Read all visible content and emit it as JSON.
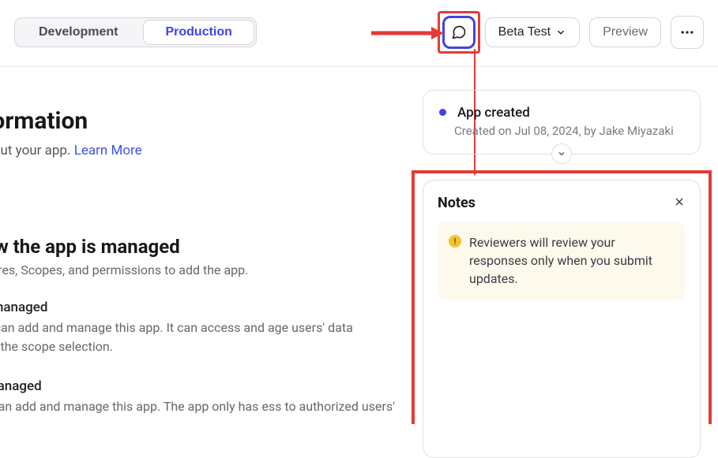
{
  "tabs": {
    "development": "Development",
    "production": "Production"
  },
  "toolbar": {
    "beta_test": "Beta Test",
    "preview": "Preview"
  },
  "page": {
    "title": "c Information",
    "subtitle_prefix": " information about your app. ",
    "learn_more": "Learn More"
  },
  "section": {
    "heading": "t how the app is managed",
    "sub": "y affect Features, Scopes, and permissions to add the app.",
    "opt1_title": "in-managed",
    "opt1_desc": "ount admins can add and manage this app. It can access and age users' data depending on the scope selection.",
    "opt2_title": "r-managed",
    "opt2_desc": "vidual users can add and manage this app. The app only has ess to authorized users' data."
  },
  "activity": {
    "title": "App created",
    "subtitle": "Created on Jul 08, 2024, by Jake Miyazaki"
  },
  "notes": {
    "heading": "Notes",
    "callout": "Reviewers will review your responses only when you submit updates."
  }
}
